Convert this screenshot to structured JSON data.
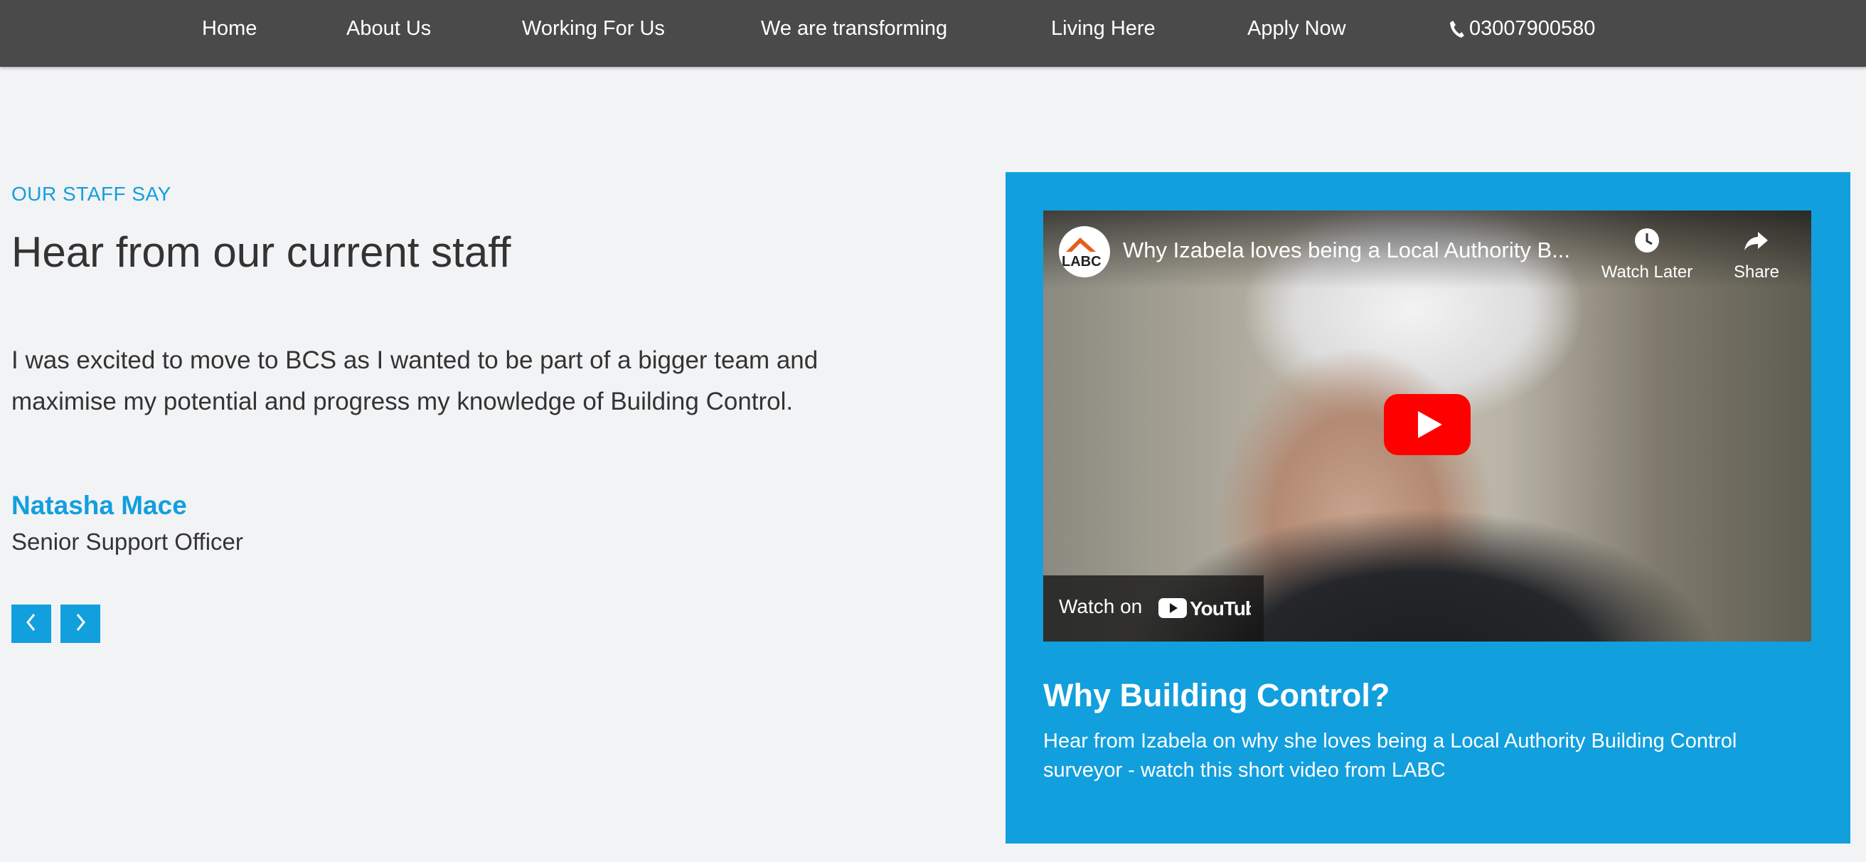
{
  "nav": {
    "items": [
      "Home",
      "About Us",
      "Working For Us",
      "We are transforming",
      "Living Here",
      "Apply Now"
    ],
    "phone": "03007900580"
  },
  "staff": {
    "eyebrow": "OUR STAFF SAY",
    "heading": "Hear from our current staff",
    "quote": "I was excited to move to BCS as I wanted to be part of a bigger team and maximise my potential and progress my knowledge of Building Control.",
    "name": "Natasha Mace",
    "role": "Senior Support Officer"
  },
  "video_card": {
    "channel_logo_text": "LABC",
    "video_title": "Why Izabela loves being a Local Authority B...",
    "watch_later": "Watch Later",
    "share": "Share",
    "watch_on": "Watch on",
    "youtube": "YouTube",
    "title": "Why Building Control?",
    "description": "Hear from Izabela on why she loves being a Local Authority Building Control surveyor - watch this short video from LABC"
  },
  "colors": {
    "nav_bg": "#4a4a4a",
    "accent": "#129fdd",
    "page_bg": "#f2f3f5",
    "youtube_red": "#ff0000"
  },
  "icons": [
    "phone-icon",
    "chevron-left-icon",
    "chevron-right-icon",
    "clock-icon",
    "share-icon",
    "play-icon",
    "youtube-icon"
  ]
}
